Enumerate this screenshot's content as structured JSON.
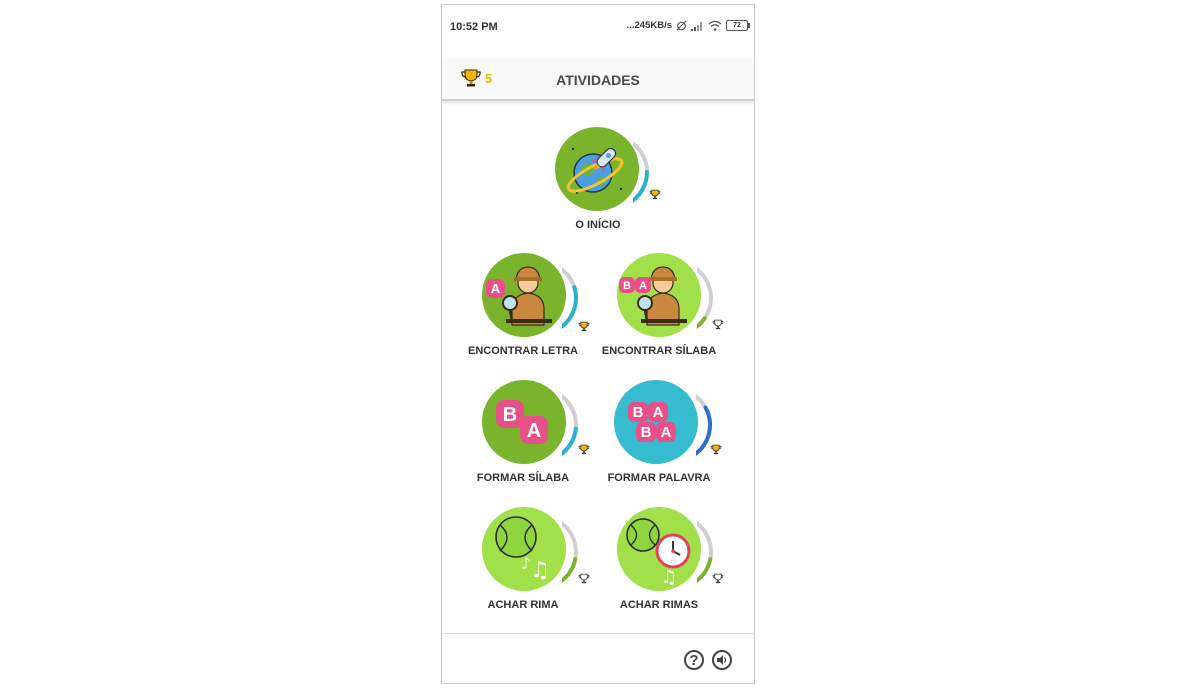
{
  "status": {
    "time": "10:52 PM",
    "speed": "...245KB/s",
    "battery": "72"
  },
  "appbar": {
    "score": "5",
    "title": "ATIVIDADES"
  },
  "activities": [
    {
      "label": "O INÍCIO",
      "progress": 0.5,
      "trophy": "gold"
    },
    {
      "label": "ENCONTRAR LETRA",
      "progress": 0.65,
      "trophy": "gold"
    },
    {
      "label": "ENCONTRAR SÍLABA",
      "progress": 0.2,
      "trophy": "gray"
    },
    {
      "label": "FORMAR SÍLABA",
      "progress": 0.45,
      "trophy": "gold"
    },
    {
      "label": "FORMAR PALAVRA",
      "progress": 0.75,
      "trophy": "gold"
    },
    {
      "label": "ACHAR RIMA",
      "progress": 0.4,
      "trophy": "gray"
    },
    {
      "label": "ACHAR RIMAS",
      "progress": 0.4,
      "trophy": "gray"
    }
  ],
  "tiles": {
    "b": "B",
    "a": "A"
  },
  "bottombar": {
    "help_label": "?"
  },
  "colors": {
    "dark_green": "#7ab42d",
    "light_green": "#a2e049",
    "teal": "#36bccf",
    "pink": "#e8508a",
    "progress_blue": "#2bb0cf",
    "progress_green": "#7ab42d",
    "progress_dark_blue": "#2e6fc9",
    "trophy_gold": "#f2b705"
  }
}
